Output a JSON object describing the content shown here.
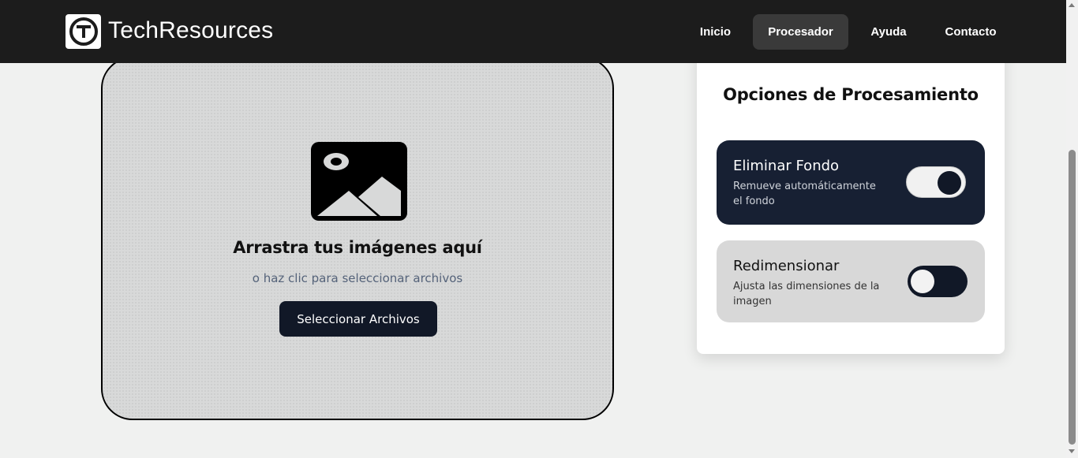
{
  "brand": {
    "name": "TechResources",
    "logo_icon": "circled-t-logo-icon"
  },
  "nav": {
    "items": [
      {
        "label": "Inicio",
        "active": false
      },
      {
        "label": "Procesador",
        "active": true
      },
      {
        "label": "Ayuda",
        "active": false
      },
      {
        "label": "Contacto",
        "active": false
      }
    ]
  },
  "dropzone": {
    "icon": "image-icon",
    "title": "Arrastra tus imágenes aquí",
    "subtitle": "o haz clic para seleccionar archivos",
    "button_label": "Seleccionar Archivos"
  },
  "options_panel": {
    "title": "Opciones de Procesamiento",
    "options": [
      {
        "title": "Eliminar Fondo",
        "description": "Remueve automáticamente el fondo",
        "enabled": true
      },
      {
        "title": "Redimensionar",
        "description": "Ajusta las dimensiones de la imagen",
        "enabled": false
      }
    ]
  },
  "colors": {
    "navbar_bg": "#1c1c1c",
    "accent_dark": "#111827",
    "option_active_bg": "#172033",
    "option_inactive_bg": "#d8d8d8",
    "page_bg": "#f0f1f0"
  }
}
